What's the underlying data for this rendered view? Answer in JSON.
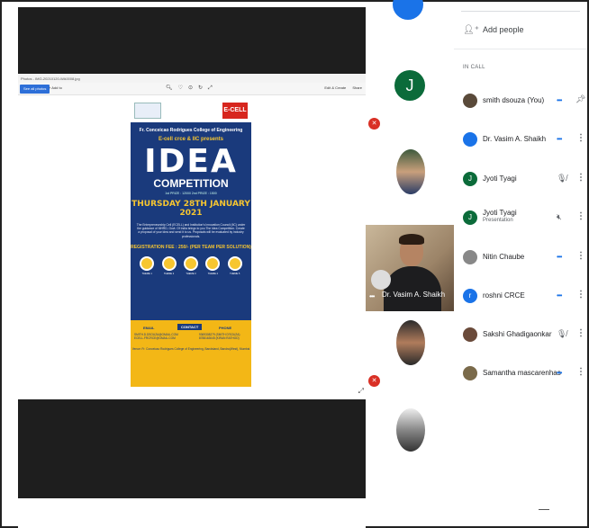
{
  "viewer": {
    "title": "Photos - IMG-20210120-WA0008.jpg",
    "see_all_photos": "See all photos",
    "add_to": "+ Add to",
    "toolbar_right": [
      "Edit & Create",
      "Share"
    ]
  },
  "poster": {
    "college_top": "Fr. Conceicao Rodrigues College of Engineering",
    "ecell_logo": "E-CELL",
    "presents": "E-cell crce & IIC presents",
    "idea": "IDEA",
    "competition": "COMPETITION",
    "prizes": "1st PRIZE : 12000 2nd PRIZE : 1500",
    "date": "THURSDAY 28TH JANUARY 2021",
    "description": "The Entrepreneurship Cell (ECELL) and Institution's Innovation Council (IIC) under the guidance of MHRD, Govt. Of India brings to you The Idea Competition. Create a proposal of your idea and send it to us. Proposals will be evaluated by industry professionals.",
    "fee": "REGISTRATION FEE : 250/- (PER TEAM PER SOLUTION)",
    "themes": [
      "THEME 1",
      "THEME 2",
      "THEME 3",
      "THEME 4",
      "THEME 5"
    ],
    "contact_badge": "CONTACT",
    "email_head": "EMAIL",
    "emails": "SMITH.D.DSOUZA@GMAIL.COM\nECELL.FRCRCE@GMAIL.COM",
    "phone_head": "PHONE",
    "phones": "9369308279 (SMITH D'SOUZA)\n8788163045 (KIRAN RATHOD)",
    "venue": "Venue: Fr. Conceicao Rodrigues College of Engineering, Bandstand, Bandra(West), Mumbai"
  },
  "tiles": {
    "roshni": "roshni CRCE",
    "jyoti": "Jyoti Tyagi",
    "jyoti_initial": "J",
    "samantha": "Samantha mascarenhas",
    "vasim": "Dr. Vasim A. Shaikh",
    "sakshi": "Sakshi Ghadigaonkar",
    "nitin": "Nitin Chaube",
    "dots": "•••"
  },
  "panel": {
    "add_people": "Add people",
    "in_call": "IN CALL",
    "participants": [
      {
        "name": "smith dsouza (You)",
        "sub": "",
        "initial": "",
        "color": "#5a4a3a"
      },
      {
        "name": "Dr. Vasim A. Shaikh",
        "sub": "",
        "initial": "",
        "color": "#1a73e8"
      },
      {
        "name": "Jyoti Tyagi",
        "sub": "",
        "initial": "J",
        "color": "#0b6b3a"
      },
      {
        "name": "Jyoti Tyagi",
        "sub": "Presentation",
        "initial": "J",
        "color": "#0b6b3a"
      },
      {
        "name": "Nitin Chaube",
        "sub": "",
        "initial": "",
        "color": "#888888"
      },
      {
        "name": "roshni CRCE",
        "sub": "",
        "initial": "r",
        "color": "#1a73e8"
      },
      {
        "name": "Sakshi Ghadigaonkar",
        "sub": "",
        "initial": "",
        "color": "#6a4a3a"
      },
      {
        "name": "Samantha mascarenhas",
        "sub": "",
        "initial": "",
        "color": "#7a6a4a"
      }
    ],
    "more_glyph": "⋮",
    "speaking_glyph": "•••",
    "muted_glyph": "🎙",
    "pin_glyph": "⊥"
  },
  "colors": {
    "stage": "#1e1e1e",
    "mic_off": "#d93025",
    "accent": "#1a73e8",
    "poster_blue": "#1a3a7c",
    "poster_yellow": "#f7c630"
  }
}
